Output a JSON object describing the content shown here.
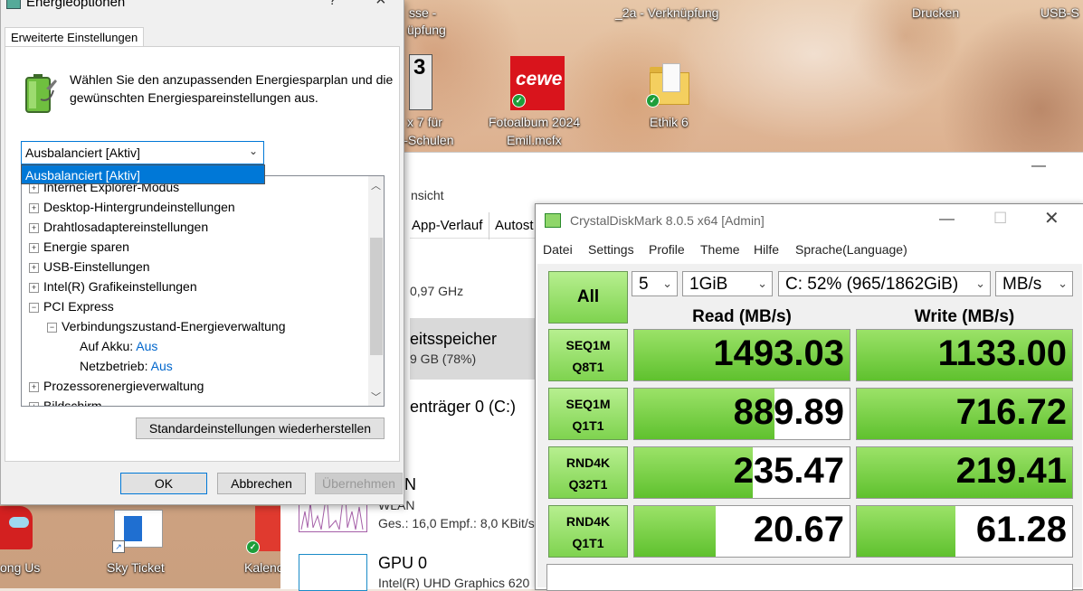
{
  "desktop": {
    "icons": [
      {
        "label_line1": "sse -",
        "label_line2": "üpfung"
      },
      {
        "label_line1": "x 7 für",
        "label_line2": "il-Schulen",
        "glyph": "3"
      },
      {
        "label_line1": "Fotoalbum 2024",
        "label_line2": "Emil.mcfx",
        "logo_text": "cewe"
      },
      {
        "label_line1": "Ethik 6"
      },
      {
        "label": "_2a - Verknüpfung"
      },
      {
        "label": "Drucken"
      },
      {
        "label": "USB-S"
      },
      {
        "label": "ong Us"
      },
      {
        "label": "Sky Ticket"
      },
      {
        "label": "Kalenc"
      }
    ],
    "accent_red": "#d9141c",
    "sync_check_color": "#1e9e3a"
  },
  "taskmgr": {
    "tabs": {
      "ansicht": "nsicht",
      "app_history": "App-Verlauf",
      "autostart": "Autost"
    },
    "cpu_speed": "0,97 GHz",
    "memory_title": "eitsspeicher",
    "memory_value": "9 GB (78%)",
    "disk_title": "enträger 0 (C:)",
    "wlan_title": "AN",
    "wlan_sub": "WLAN",
    "wlan_stats": "Ges.: 16,0  Empf.: 8,0 KBit/s",
    "gpu_title": "GPU 0",
    "gpu_sub": "Intel(R) UHD Graphics 620"
  },
  "energy": {
    "title": "Energieoptionen",
    "help_button": "?",
    "close_button": "×",
    "tab_label": "Erweiterte Einstellungen",
    "description": "Wählen Sie den anzupassenden Energiesparplan und die gewünschten Energiespareinstellungen aus.",
    "plan_selected": "Ausbalanciert [Aktiv]",
    "dropdown_highlight": "Ausbalanciert [Aktiv]",
    "tree": {
      "partial_top": "Internet Explorer-Modus",
      "items": [
        "Desktop-Hintergrundeinstellungen",
        "Drahtlosadaptereinstellungen",
        "Energie sparen",
        "USB-Einstellungen",
        "Intel(R) Grafikeinstellungen",
        "PCI Express"
      ],
      "sub_item": "Verbindungszustand-Energieverwaltung",
      "battery_label": "Auf Akku:",
      "battery_value": "Aus",
      "plugged_label": "Netzbetrieb:",
      "plugged_value": "Aus",
      "after": "Prozessorenergieverwaltung",
      "partial_bottom": "Bildschirm"
    },
    "restore_button": "Standardeinstellungen wiederherstellen",
    "ok_button": "OK",
    "cancel_button": "Abbrechen",
    "apply_button": "Übernehmen"
  },
  "cdm": {
    "title": "CrystalDiskMark 8.0.5 x64 [Admin]",
    "menu": [
      "Datei",
      "Settings",
      "Profile",
      "Theme",
      "Hilfe",
      "Sprache(Language)"
    ],
    "all_button": "All",
    "runs": "5",
    "size": "1GiB",
    "drive": "C: 52% (965/1862GiB)",
    "unit": "MB/s",
    "read_header": "Read (MB/s)",
    "write_header": "Write (MB/s)",
    "tests": [
      {
        "line1": "SEQ1M",
        "line2": "Q8T1",
        "read": "1493.03",
        "write": "1133.00",
        "read_fill": 1.0,
        "write_fill": 1.0
      },
      {
        "line1": "SEQ1M",
        "line2": "Q1T1",
        "read": "889.89",
        "write": "716.72",
        "read_fill": 0.65,
        "write_fill": 1.0
      },
      {
        "line1": "RND4K",
        "line2": "Q32T1",
        "read": "235.47",
        "write": "219.41",
        "read_fill": 0.55,
        "write_fill": 1.0
      },
      {
        "line1": "RND4K",
        "line2": "Q1T1",
        "read": "20.67",
        "write": "61.28",
        "read_fill": 0.38,
        "write_fill": 0.46
      }
    ],
    "bar_green": "#5fc12e"
  }
}
